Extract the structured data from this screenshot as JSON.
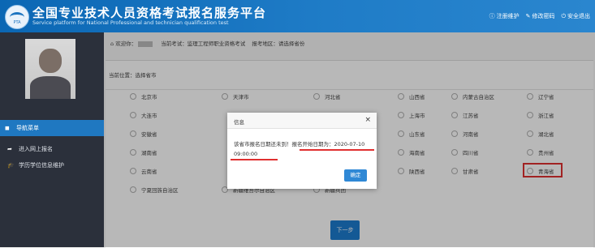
{
  "header": {
    "title": "全国专业技术人员资格考试报名服务平台",
    "subtitle": "Service platform for National Professional and technician qualification test",
    "logo_text": "PTA",
    "links": [
      {
        "icon": "info-icon",
        "label": "注册维护"
      },
      {
        "icon": "edit-icon",
        "label": "修改密码"
      },
      {
        "icon": "power-icon",
        "label": "安全退出"
      }
    ]
  },
  "sidebar": {
    "nav_title": "导航菜单",
    "items": [
      {
        "icon": "arrow-icon",
        "label": "进入网上报名"
      },
      {
        "icon": "graduation-cap-icon",
        "label": "学历学位信息维护"
      }
    ]
  },
  "main": {
    "welcome_prefix": "欢迎你：",
    "current_exam": "当前考试：监理工程师职业资格考试",
    "exam_area": "报考地区：请选择省份",
    "breadcrumb": "当前位置：选择省市",
    "provinces": [
      "北京市",
      "天津市",
      "河北省",
      "山西省",
      "内蒙古自治区",
      "辽宁省",
      "大连市",
      "",
      "",
      "上海市",
      "江苏省",
      "浙江省",
      "安徽省",
      "",
      "",
      "山东省",
      "河南省",
      "湖北省",
      "湖南省",
      "",
      "",
      "海南省",
      "四川省",
      "贵州省",
      "云南省",
      "",
      "",
      "陕西省",
      "甘肃省",
      "青海省",
      "宁夏回族自治区",
      "新疆维吾尔自治区",
      "新疆兵团"
    ],
    "next_button": "下一步"
  },
  "dialog": {
    "title": "信息",
    "close": "×",
    "message": "该省市报名日期还未到！报名开始日期为：2020-07-10 09:00:00",
    "ok": "确定"
  },
  "colors": {
    "header": "#1f7cc7",
    "sidebar": "#2b303b",
    "accent": "#1f78c1",
    "annotation": "#e03030"
  }
}
